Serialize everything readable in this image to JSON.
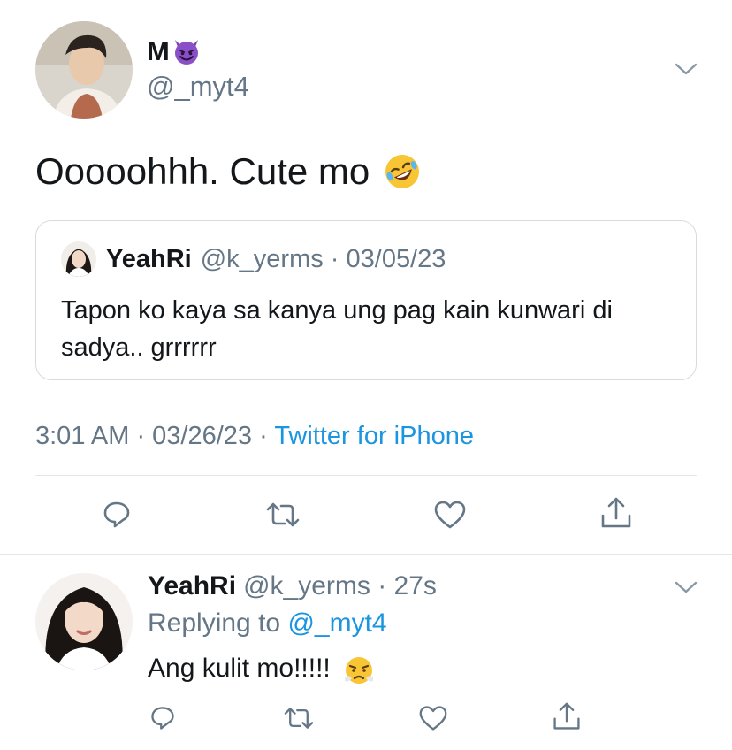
{
  "main_tweet": {
    "display_name": "M",
    "name_emoji": "smiling-imp-emoji",
    "handle": "@_myt4",
    "text": "Ooooohhh. Cute mo",
    "text_emoji": "rofl-emoji",
    "timestamp": "3:01 AM · 03/26/23 · ",
    "source": "Twitter for iPhone",
    "actions": [
      "reply-icon",
      "retweet-icon",
      "like-icon",
      "share-icon"
    ]
  },
  "quoted_tweet": {
    "display_name": "YeahRi",
    "handle_date": "@k_yerms · 03/05/23",
    "text": "Tapon ko kaya sa kanya ung pag kain kunwari di sadya.. grrrrrr"
  },
  "reply_tweet": {
    "display_name": "YeahRi",
    "handle_time": "@k_yerms · 27s",
    "replying_prefix": "Replying to ",
    "replying_to": "@_myt4",
    "text": "Ang kulit mo!!!!!",
    "text_emoji": "triumph-emoji",
    "actions": [
      "reply-icon",
      "retweet-icon",
      "like-icon",
      "share-icon"
    ]
  },
  "colors": {
    "secondary_text": "#657786",
    "link": "#1b95e0",
    "divider": "#e1e8ed",
    "icon": "#657786"
  }
}
